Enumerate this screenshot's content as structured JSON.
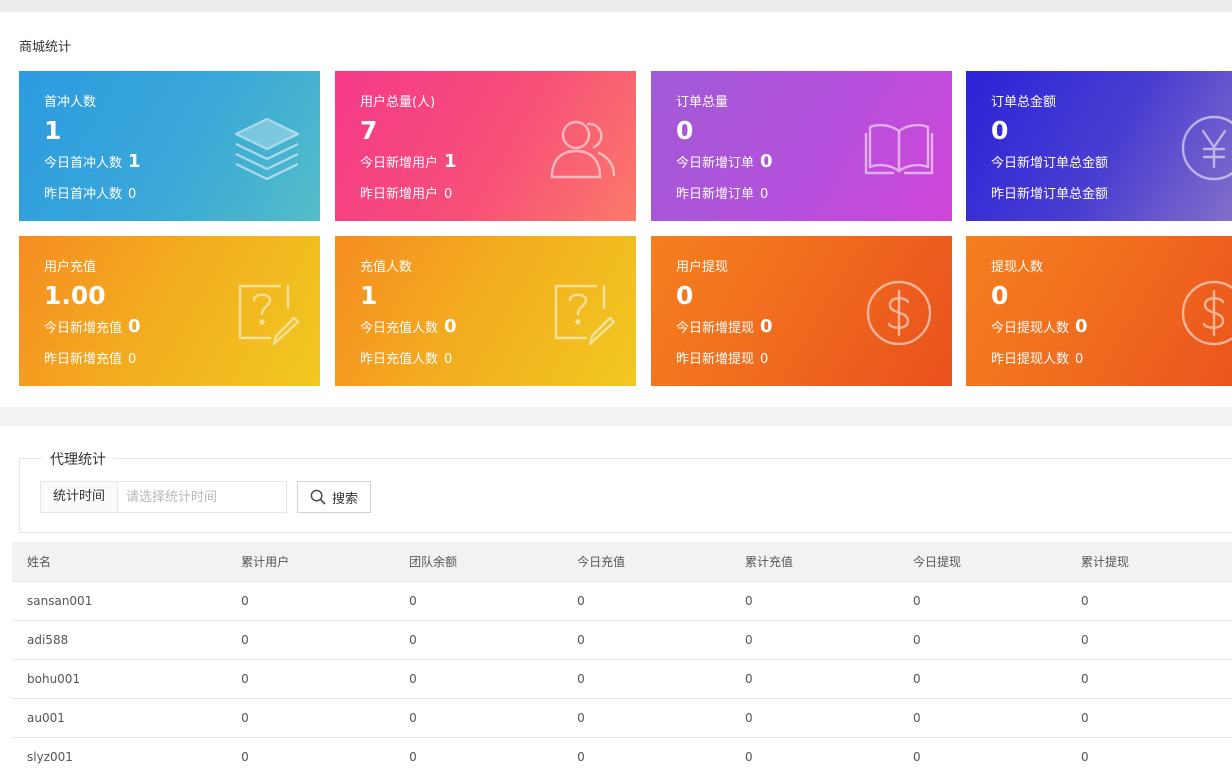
{
  "stats_panel": {
    "title": "商城统计",
    "cards": [
      {
        "title": "首冲人数",
        "value": "1",
        "today_label": "今日首冲人数",
        "today_value": "1",
        "yesterday_label": "昨日首冲人数",
        "yesterday_value": "0",
        "icon": "layers-icon",
        "gradient": "blue"
      },
      {
        "title": "用户总量(人)",
        "value": "7",
        "today_label": "今日新增用户",
        "today_value": "1",
        "yesterday_label": "昨日新增用户",
        "yesterday_value": "0",
        "icon": "users-icon",
        "gradient": "pink"
      },
      {
        "title": "订单总量",
        "value": "0",
        "today_label": "今日新增订单",
        "today_value": "0",
        "yesterday_label": "昨日新增订单",
        "yesterday_value": "0",
        "icon": "book-icon",
        "gradient": "purple"
      },
      {
        "title": "订单总金额",
        "value": "0",
        "today_label": "今日新增订单总金额",
        "today_value": "",
        "yesterday_label": "昨日新增订单总金额",
        "yesterday_value": "",
        "icon": "yen-icon",
        "gradient": "indigo"
      },
      {
        "title": "用户充值",
        "value": "1.00",
        "today_label": "今日新增充值",
        "today_value": "0",
        "yesterday_label": "昨日新增充值",
        "yesterday_value": "0",
        "icon": "question-note-icon",
        "gradient": "orange"
      },
      {
        "title": "充值人数",
        "value": "1",
        "today_label": "今日充值人数",
        "today_value": "0",
        "yesterday_label": "昨日充值人数",
        "yesterday_value": "0",
        "icon": "question-note-icon",
        "gradient": "orange"
      },
      {
        "title": "用户提现",
        "value": "0",
        "today_label": "今日新增提现",
        "today_value": "0",
        "yesterday_label": "昨日新增提现",
        "yesterday_value": "0",
        "icon": "dollar-icon",
        "gradient": "red"
      },
      {
        "title": "提现人数",
        "value": "0",
        "today_label": "今日提现人数",
        "today_value": "0",
        "yesterday_label": "昨日提现人数",
        "yesterday_value": "0",
        "icon": "dollar-icon",
        "gradient": "red"
      }
    ]
  },
  "agents_panel": {
    "legend": "代理统计",
    "filter": {
      "label": "统计时间",
      "placeholder": "请选择统计时间",
      "value": ""
    },
    "search_button": "搜索",
    "columns": [
      "姓名",
      "累计用户",
      "团队余额",
      "今日充值",
      "累计充值",
      "今日提现",
      "累计提现"
    ],
    "rows": [
      [
        "sansan001",
        "0",
        "0",
        "0",
        "0",
        "0",
        "0"
      ],
      [
        "adi588",
        "0",
        "0",
        "0",
        "0",
        "0",
        "0"
      ],
      [
        "bohu001",
        "0",
        "0",
        "0",
        "0",
        "0",
        "0"
      ],
      [
        "au001",
        "0",
        "0",
        "0",
        "0",
        "0",
        "0"
      ],
      [
        "slyz001",
        "0",
        "0",
        "0",
        "0",
        "0",
        "0"
      ]
    ]
  }
}
